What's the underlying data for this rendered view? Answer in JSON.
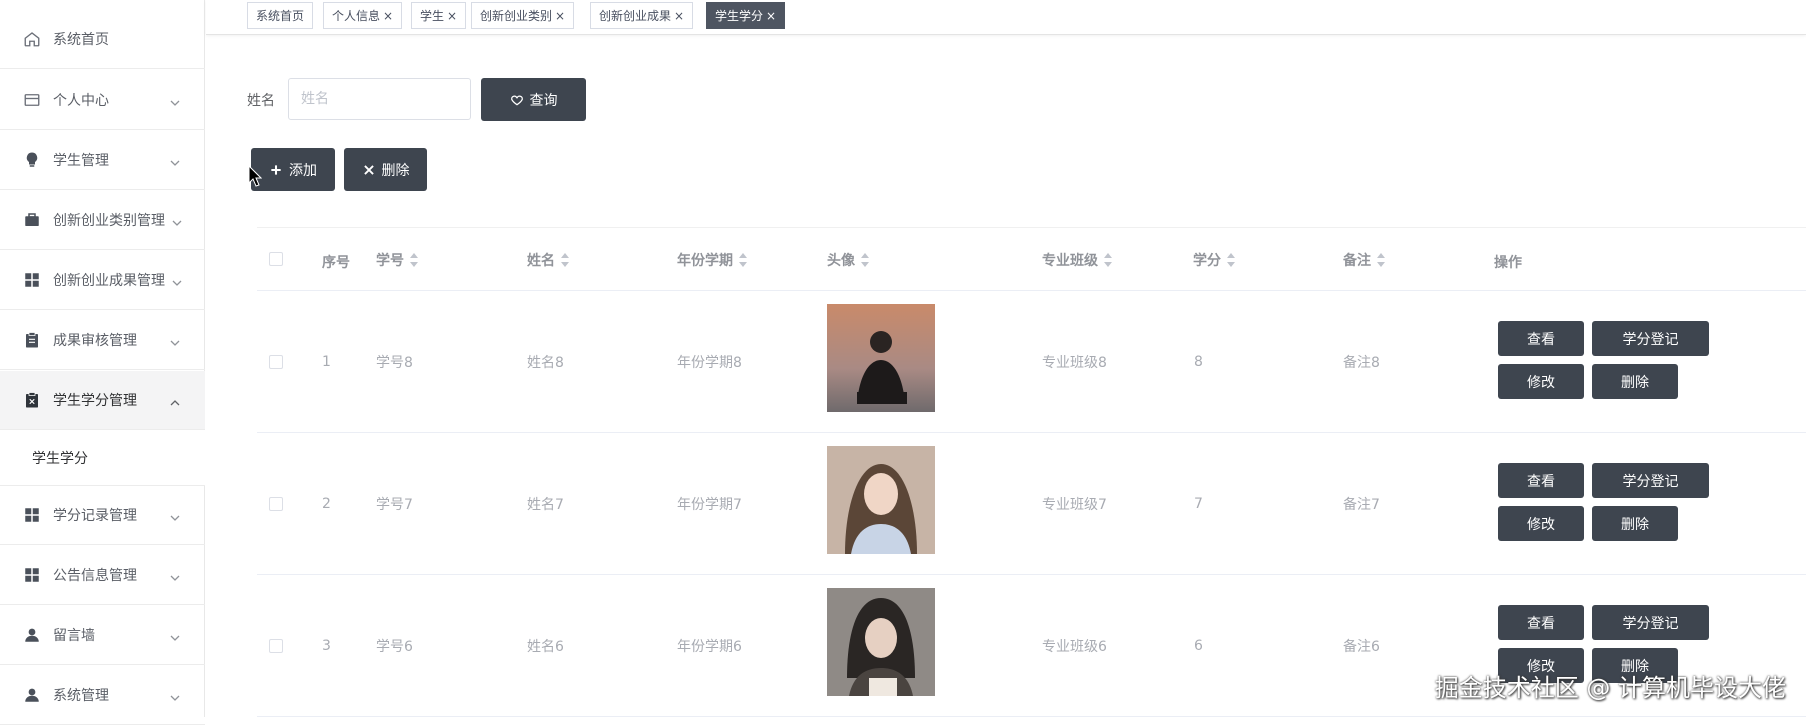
{
  "sidebar": {
    "items": [
      {
        "label": "系统首页",
        "icon": "home-icon"
      },
      {
        "label": "个人中心",
        "icon": "card-icon"
      },
      {
        "label": "学生管理",
        "icon": "bulb-icon"
      },
      {
        "label": "创新创业类别管理",
        "icon": "briefcase-icon"
      },
      {
        "label": "创新创业成果管理",
        "icon": "grid-icon"
      },
      {
        "label": "成果审核管理",
        "icon": "clipboard-icon"
      },
      {
        "label": "学生学分管理",
        "icon": "clipboard-x-icon"
      },
      {
        "label": "学分记录管理",
        "icon": "grid-icon"
      },
      {
        "label": "公告信息管理",
        "icon": "grid-icon"
      },
      {
        "label": "留言墙",
        "icon": "user-icon"
      },
      {
        "label": "系统管理",
        "icon": "user-icon"
      }
    ],
    "submenu": {
      "label": "学生学分"
    }
  },
  "tabs": [
    {
      "label": "系统首页"
    },
    {
      "label": "个人信息",
      "close": "×"
    },
    {
      "label": "学生",
      "close": "×"
    },
    {
      "label": "创新创业类别",
      "close": "×"
    },
    {
      "label": "创新创业成果",
      "close": "×"
    },
    {
      "label": "学生学分",
      "close": "×"
    }
  ],
  "search": {
    "label": "姓名",
    "placeholder": "姓名",
    "value": "",
    "button": "查询"
  },
  "toolbar": {
    "add": "添加",
    "delete": "删除"
  },
  "table": {
    "headers": {
      "index": "序号",
      "student_no": "学号",
      "name": "姓名",
      "year_term": "年份学期",
      "avatar": "头像",
      "major_class": "专业班级",
      "credit": "学分",
      "remark": "备注",
      "actions": "操作"
    },
    "rows": [
      {
        "index": "1",
        "student_no": "学号8",
        "name": "姓名8",
        "year_term": "年份学期8",
        "major_class": "专业班级8",
        "credit": "8",
        "remark": "备注8"
      },
      {
        "index": "2",
        "student_no": "学号7",
        "name": "姓名7",
        "year_term": "年份学期7",
        "major_class": "专业班级7",
        "credit": "7",
        "remark": "备注7"
      },
      {
        "index": "3",
        "student_no": "学号6",
        "name": "姓名6",
        "year_term": "年份学期6",
        "major_class": "专业班级6",
        "credit": "6",
        "remark": "备注6"
      }
    ],
    "row_actions": {
      "view": "查看",
      "register": "学分登记",
      "edit": "修改",
      "delete": "删除"
    }
  },
  "watermark": "掘金技术社区 @ 计算机毕设大佬",
  "colors": {
    "button": "#3e454f",
    "active_tab": "#4e5561"
  }
}
